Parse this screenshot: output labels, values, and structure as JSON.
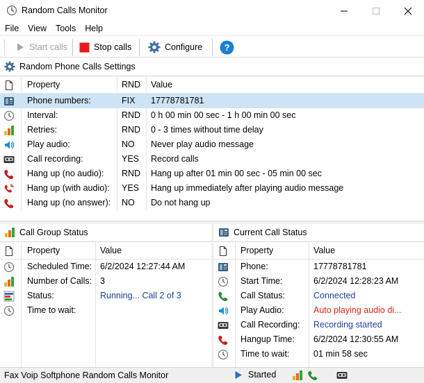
{
  "window": {
    "title": "Random Calls Monitor"
  },
  "menu": [
    "File",
    "View",
    "Tools",
    "Help"
  ],
  "toolbar": {
    "start_label": "Start calls",
    "stop_label": "Stop calls",
    "configure_label": "Configure"
  },
  "settings": {
    "title": "Random Phone Calls Settings",
    "headers": {
      "property": "Property",
      "rnd": "RND",
      "value": "Value"
    },
    "rows": [
      {
        "icon": "fax-phone-icon",
        "property": "Phone numbers:",
        "rnd": "FIX",
        "value": "17778781781"
      },
      {
        "icon": "clock-icon",
        "property": "Interval:",
        "rnd": "RND",
        "value": "0 h 00 min 00 sec - 1 h 00 min 00 sec"
      },
      {
        "icon": "bar-chart-icon",
        "property": "Retries:",
        "rnd": "RND",
        "value": "0 - 3 times without time delay"
      },
      {
        "icon": "speaker-icon",
        "property": "Play audio:",
        "rnd": "NO",
        "value": "Never play audio message"
      },
      {
        "icon": "tape-recorder-icon",
        "property": "Call recording:",
        "rnd": "YES",
        "value": "Record calls"
      },
      {
        "icon": "hangup-phone-icon",
        "property": "Hang up (no audio):",
        "rnd": "RND",
        "value": "Hang up after 01 min 00 sec - 05 min 00 sec"
      },
      {
        "icon": "hangup-audio-icon",
        "property": "Hang up (with audio):",
        "rnd": "YES",
        "value": "Hang up immediately after playing audio message"
      },
      {
        "icon": "hangup-phone-icon",
        "property": "Hang up (no answer):",
        "rnd": "NO",
        "value": "Do not hang up"
      }
    ]
  },
  "group_status": {
    "title": "Call Group Status",
    "headers": {
      "property": "Property",
      "value": "Value"
    },
    "rows": [
      {
        "icon": "clock-icon",
        "property": "Scheduled Time:",
        "value": "6/2/2024 12:27:44 AM",
        "style": ""
      },
      {
        "icon": "bar-chart-icon",
        "property": "Number of Calls:",
        "value": "3",
        "style": ""
      },
      {
        "icon": "status-chart-icon",
        "property": "Status:",
        "value": "Running... Call 2 of 3",
        "style": "blue"
      },
      {
        "icon": "clock-icon",
        "property": "Time to wait:",
        "value": "",
        "style": ""
      }
    ]
  },
  "current_status": {
    "title": "Current Call Status",
    "headers": {
      "property": "Property",
      "value": "Value"
    },
    "rows": [
      {
        "icon": "fax-phone-icon",
        "property": "Phone:",
        "value": "17778781781",
        "style": ""
      },
      {
        "icon": "clock-icon",
        "property": "Start Time:",
        "value": "6/2/2024 12:28:23 AM",
        "style": ""
      },
      {
        "icon": "green-phone-icon",
        "property": "Call Status:",
        "value": "Connected",
        "style": "blue"
      },
      {
        "icon": "speaker-icon",
        "property": "Play Audio:",
        "value": "Auto playing audio di...",
        "style": "red"
      },
      {
        "icon": "tape-recorder-icon",
        "property": "Call Recording:",
        "value": "Recording started",
        "style": "blue"
      },
      {
        "icon": "hangup-phone-icon",
        "property": "Hangup Time:",
        "value": "6/2/2024 12:30:55 AM",
        "style": ""
      },
      {
        "icon": "clock-icon",
        "property": "Time to wait:",
        "value": "01 min 58 sec",
        "style": ""
      }
    ]
  },
  "statusbar": {
    "text": "Fax Voip Softphone Random Calls Monitor",
    "state": "Started"
  },
  "colors": {
    "selection": "#cde4f7",
    "blue_text": "#1f3f9a",
    "red_text": "#e0221b",
    "stop_red": "#e8191b",
    "help_blue": "#1b7fd6"
  }
}
